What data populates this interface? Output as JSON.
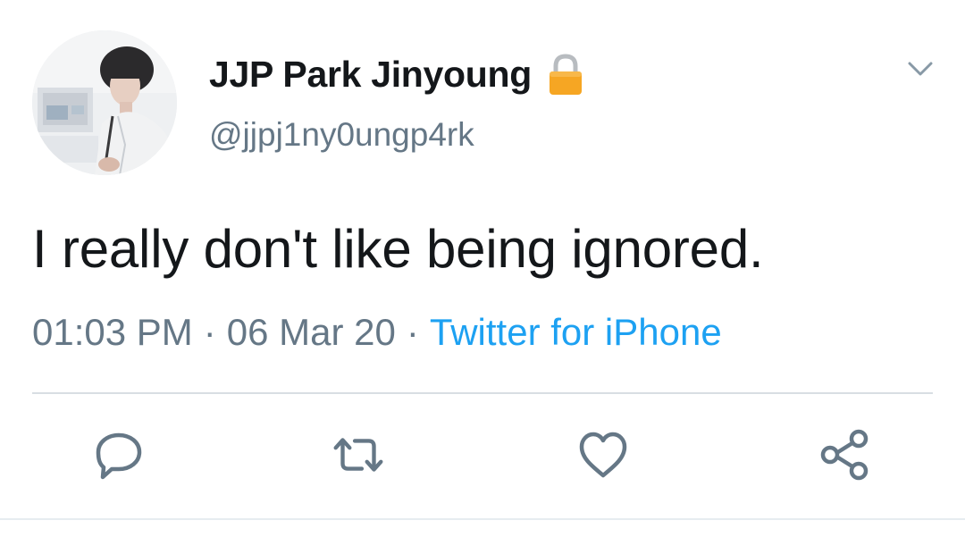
{
  "author": {
    "display_name": "JJP Park Jinyoung",
    "handle": "@jjpj1ny0ungp4rk",
    "protected_icon": "lock-icon"
  },
  "tweet": {
    "text": "I really don't like being ignored.",
    "time": "01:03 PM",
    "separator": "·",
    "date": "06 Mar 20",
    "source": "Twitter for iPhone"
  },
  "actions": {
    "reply_icon": "speech-bubble-icon",
    "retweet_icon": "retweet-arrows-icon",
    "like_icon": "heart-icon",
    "share_icon": "share-icon"
  },
  "colors": {
    "text_primary": "#14171a",
    "text_secondary": "#657786",
    "link_blue": "#1da1f2",
    "icon_gray": "#657786",
    "divider": "#d8dee3"
  }
}
